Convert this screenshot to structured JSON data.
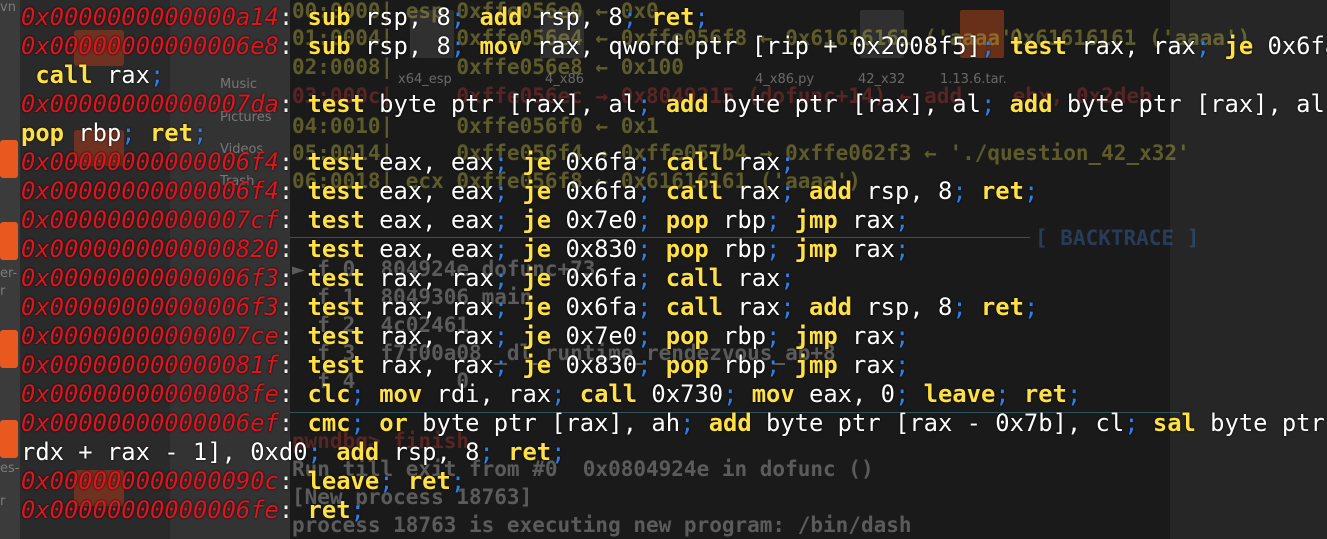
{
  "background": {
    "desktop_labels": [
      "Music",
      "Pictures",
      "Videos",
      "Trash"
    ],
    "file_labels": [
      "x64_esp",
      "4_x86",
      "4_x86.py",
      "42_x32",
      "1.13.6.tar."
    ],
    "side_fragments": [
      "vn",
      "er-",
      "r",
      "es-",
      "r"
    ],
    "stack_lines": [
      "00:0000| esp 0xffe056e0 ← 0x0",
      "01:0004|     0xffe056e4 ← 0xffe056f8 ← 0x61616161 ('aaaa')",
      "02:0008|     0xffe056e8 ← 0x100",
      "03:000c|     0xffe056ec → 0x8049215 (dofunc+14) ← add    ebx, 0x2deb",
      "04:0010|     0xffe056f0 ← 0x1",
      "05:0014|     0xffe056f4 → 0xffe057b4 → 0xffe062f3 ← './question_42_x32'",
      "06:0018| ecx 0xffe056f8 ← 0x61616161 ('aaaa')"
    ],
    "right_fragment": "0x61616161 ('aaaa')",
    "backtrace_header": "[ BACKTRACE ]",
    "backtrace_lines": [
      "► f 0  804924e dofunc+73",
      "  f 1  8049306 main",
      "  f 2  4c02461",
      "  f 3  f7f00a08 _dl_runtime_rendezvous_ab+8",
      "  f 4        0"
    ],
    "prompt": "pwndbg> finish",
    "run_lines": [
      "Run till exit from #0  0x0804924e in dofunc ()",
      "[New process 18763]",
      "process 18763 is executing new program: /bin/dash"
    ]
  },
  "gadgets": [
    [
      [
        "a",
        "0x0000000000000a14"
      ],
      [
        "c",
        ": "
      ],
      [
        "k",
        "sub"
      ],
      [
        "o",
        " rsp, 8"
      ],
      [
        "s",
        "; "
      ],
      [
        "k",
        "add"
      ],
      [
        "o",
        " rsp, 8"
      ],
      [
        "s",
        "; "
      ],
      [
        "k",
        "ret"
      ],
      [
        "s",
        ";"
      ]
    ],
    [
      [
        "a",
        "0x00000000000006e8"
      ],
      [
        "c",
        ": "
      ],
      [
        "k",
        "sub"
      ],
      [
        "o",
        " rsp, 8"
      ],
      [
        "s",
        "; "
      ],
      [
        "k",
        "mov"
      ],
      [
        "o",
        " rax, qword ptr [rip + 0x2008f5]"
      ],
      [
        "s",
        "; "
      ],
      [
        "k",
        "test"
      ],
      [
        "o",
        " rax, rax"
      ],
      [
        "s",
        "; "
      ],
      [
        "k",
        "je"
      ],
      [
        "o",
        " 0x6fa"
      ],
      [
        "s",
        ";"
      ]
    ],
    [
      [
        "o",
        " "
      ],
      [
        "k",
        "call"
      ],
      [
        "o",
        " rax"
      ],
      [
        "s",
        ";"
      ]
    ],
    [
      [
        "a",
        "0x00000000000007da"
      ],
      [
        "c",
        ": "
      ],
      [
        "k",
        "test"
      ],
      [
        "o",
        " byte ptr [rax], al"
      ],
      [
        "s",
        "; "
      ],
      [
        "k",
        "add"
      ],
      [
        "o",
        " byte ptr [rax], al"
      ],
      [
        "s",
        "; "
      ],
      [
        "k",
        "add"
      ],
      [
        "o",
        " byte ptr [rax], al"
      ],
      [
        "s",
        ";"
      ]
    ],
    [
      [
        "k",
        "pop"
      ],
      [
        "o",
        " rbp"
      ],
      [
        "s",
        "; "
      ],
      [
        "k",
        "ret"
      ],
      [
        "s",
        ";"
      ]
    ],
    [
      [
        "a",
        "0x00000000000006f4"
      ],
      [
        "c",
        ": "
      ],
      [
        "k",
        "test"
      ],
      [
        "o",
        " eax, eax"
      ],
      [
        "s",
        "; "
      ],
      [
        "k",
        "je"
      ],
      [
        "o",
        " 0x6fa"
      ],
      [
        "s",
        "; "
      ],
      [
        "k",
        "call"
      ],
      [
        "o",
        " rax"
      ],
      [
        "s",
        ";"
      ]
    ],
    [
      [
        "a",
        "0x00000000000006f4"
      ],
      [
        "c",
        ": "
      ],
      [
        "k",
        "test"
      ],
      [
        "o",
        " eax, eax"
      ],
      [
        "s",
        "; "
      ],
      [
        "k",
        "je"
      ],
      [
        "o",
        " 0x6fa"
      ],
      [
        "s",
        "; "
      ],
      [
        "k",
        "call"
      ],
      [
        "o",
        " rax"
      ],
      [
        "s",
        "; "
      ],
      [
        "k",
        "add"
      ],
      [
        "o",
        " rsp, 8"
      ],
      [
        "s",
        "; "
      ],
      [
        "k",
        "ret"
      ],
      [
        "s",
        ";"
      ]
    ],
    [
      [
        "a",
        "0x00000000000007cf"
      ],
      [
        "c",
        ": "
      ],
      [
        "k",
        "test"
      ],
      [
        "o",
        " eax, eax"
      ],
      [
        "s",
        "; "
      ],
      [
        "k",
        "je"
      ],
      [
        "o",
        " 0x7e0"
      ],
      [
        "s",
        "; "
      ],
      [
        "k",
        "pop"
      ],
      [
        "o",
        " rbp"
      ],
      [
        "s",
        "; "
      ],
      [
        "k",
        "jmp"
      ],
      [
        "o",
        " rax"
      ],
      [
        "s",
        ";"
      ]
    ],
    [
      [
        "a",
        "0x0000000000000820"
      ],
      [
        "c",
        ": "
      ],
      [
        "k",
        "test"
      ],
      [
        "o",
        " eax, eax"
      ],
      [
        "s",
        "; "
      ],
      [
        "k",
        "je"
      ],
      [
        "o",
        " 0x830"
      ],
      [
        "s",
        "; "
      ],
      [
        "k",
        "pop"
      ],
      [
        "o",
        " rbp"
      ],
      [
        "s",
        "; "
      ],
      [
        "k",
        "jmp"
      ],
      [
        "o",
        " rax"
      ],
      [
        "s",
        ";"
      ]
    ],
    [
      [
        "a",
        "0x00000000000006f3"
      ],
      [
        "c",
        ": "
      ],
      [
        "k",
        "test"
      ],
      [
        "o",
        " rax, rax"
      ],
      [
        "s",
        "; "
      ],
      [
        "k",
        "je"
      ],
      [
        "o",
        " 0x6fa"
      ],
      [
        "s",
        "; "
      ],
      [
        "k",
        "call"
      ],
      [
        "o",
        " rax"
      ],
      [
        "s",
        ";"
      ]
    ],
    [
      [
        "a",
        "0x00000000000006f3"
      ],
      [
        "c",
        ": "
      ],
      [
        "k",
        "test"
      ],
      [
        "o",
        " rax, rax"
      ],
      [
        "s",
        "; "
      ],
      [
        "k",
        "je"
      ],
      [
        "o",
        " 0x6fa"
      ],
      [
        "s",
        "; "
      ],
      [
        "k",
        "call"
      ],
      [
        "o",
        " rax"
      ],
      [
        "s",
        "; "
      ],
      [
        "k",
        "add"
      ],
      [
        "o",
        " rsp, 8"
      ],
      [
        "s",
        "; "
      ],
      [
        "k",
        "ret"
      ],
      [
        "s",
        ";"
      ]
    ],
    [
      [
        "a",
        "0x00000000000007ce"
      ],
      [
        "c",
        ": "
      ],
      [
        "k",
        "test"
      ],
      [
        "o",
        " rax, rax"
      ],
      [
        "s",
        "; "
      ],
      [
        "k",
        "je"
      ],
      [
        "o",
        " 0x7e0"
      ],
      [
        "s",
        "; "
      ],
      [
        "k",
        "pop"
      ],
      [
        "o",
        " rbp"
      ],
      [
        "s",
        "; "
      ],
      [
        "k",
        "jmp"
      ],
      [
        "o",
        " rax"
      ],
      [
        "s",
        ";"
      ]
    ],
    [
      [
        "a",
        "0x000000000000081f"
      ],
      [
        "c",
        ": "
      ],
      [
        "k",
        "test"
      ],
      [
        "o",
        " rax, rax"
      ],
      [
        "s",
        "; "
      ],
      [
        "k",
        "je"
      ],
      [
        "o",
        " 0x830"
      ],
      [
        "s",
        "; "
      ],
      [
        "k",
        "pop"
      ],
      [
        "o",
        " rbp"
      ],
      [
        "s",
        "; "
      ],
      [
        "k",
        "jmp"
      ],
      [
        "o",
        " rax"
      ],
      [
        "s",
        ";"
      ]
    ],
    [
      [
        "a",
        "0x00000000000008fe"
      ],
      [
        "c",
        ": "
      ],
      [
        "k",
        "clc"
      ],
      [
        "s",
        "; "
      ],
      [
        "k",
        "mov"
      ],
      [
        "o",
        " rdi, rax"
      ],
      [
        "s",
        "; "
      ],
      [
        "k",
        "call"
      ],
      [
        "o",
        " 0x730"
      ],
      [
        "s",
        "; "
      ],
      [
        "k",
        "mov"
      ],
      [
        "o",
        " eax, 0"
      ],
      [
        "s",
        "; "
      ],
      [
        "k",
        "leave"
      ],
      [
        "s",
        "; "
      ],
      [
        "k",
        "ret"
      ],
      [
        "s",
        ";"
      ]
    ],
    [
      [
        "a",
        "0x00000000000006ef"
      ],
      [
        "c",
        ": "
      ],
      [
        "k",
        "cmc"
      ],
      [
        "s",
        "; "
      ],
      [
        "k",
        "or"
      ],
      [
        "o",
        " byte ptr [rax], ah"
      ],
      [
        "s",
        "; "
      ],
      [
        "k",
        "add"
      ],
      [
        "o",
        " byte ptr [rax - 0x7b], cl"
      ],
      [
        "s",
        "; "
      ],
      [
        "k",
        "sal"
      ],
      [
        "o",
        " byte ptr ["
      ]
    ],
    [
      [
        "o",
        "rdx + rax - 1], 0xd0"
      ],
      [
        "s",
        "; "
      ],
      [
        "k",
        "add"
      ],
      [
        "o",
        " rsp, 8"
      ],
      [
        "s",
        "; "
      ],
      [
        "k",
        "ret"
      ],
      [
        "s",
        ";"
      ]
    ],
    [
      [
        "a",
        "0x000000000000090c"
      ],
      [
        "c",
        ": "
      ],
      [
        "k",
        "leave"
      ],
      [
        "s",
        "; "
      ],
      [
        "k",
        "ret"
      ],
      [
        "s",
        ";"
      ]
    ],
    [
      [
        "a",
        "0x00000000000006fe"
      ],
      [
        "c",
        ": "
      ],
      [
        "k",
        "ret"
      ],
      [
        "s",
        ";"
      ]
    ]
  ]
}
